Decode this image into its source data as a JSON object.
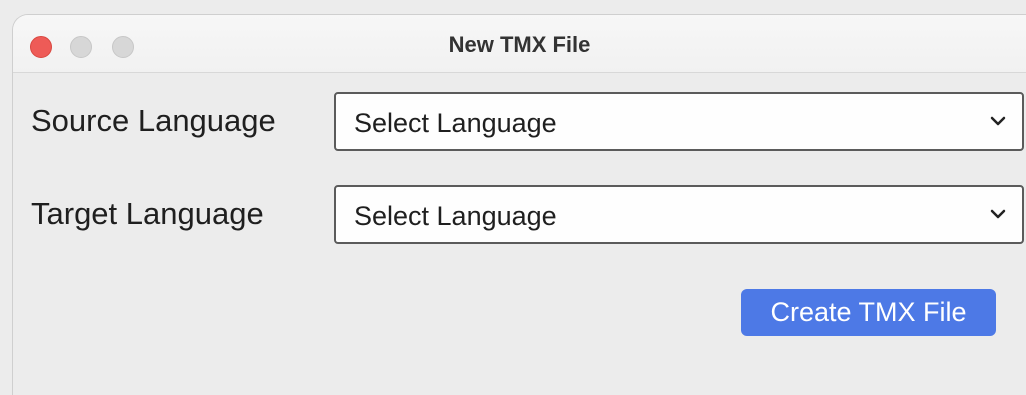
{
  "window": {
    "title": "New TMX File"
  },
  "form": {
    "source_language": {
      "label": "Source Language",
      "selected_value": "Select Language",
      "icon": "chevron-down-icon"
    },
    "target_language": {
      "label": "Target Language",
      "selected_value": "Select Language",
      "icon": "chevron-down-icon"
    }
  },
  "actions": {
    "create_label": "Create TMX File"
  },
  "colors": {
    "accent": "#4d79e6",
    "close_button": "#ee5b57"
  }
}
